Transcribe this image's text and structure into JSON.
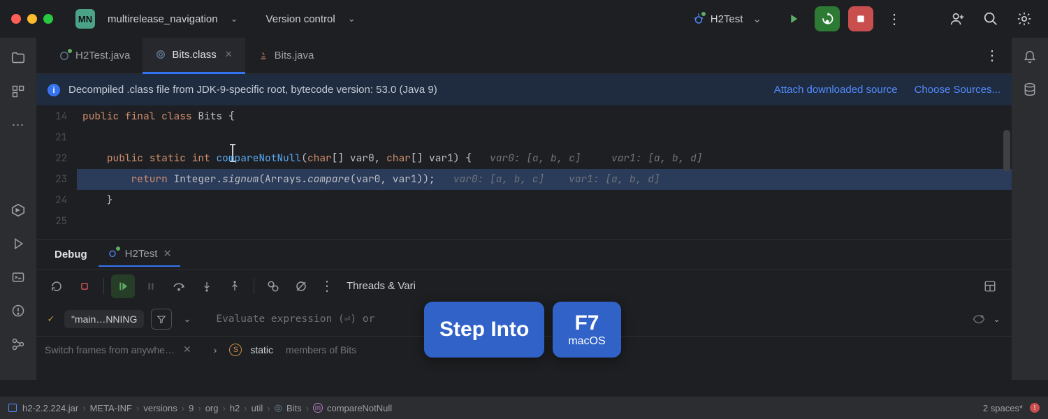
{
  "project": {
    "badge": "MN",
    "name": "multirelease_navigation"
  },
  "vc": {
    "label": "Version control"
  },
  "run_config": {
    "name": "H2Test"
  },
  "tabs": [
    {
      "label": "H2Test.java",
      "active": false,
      "has_dot": true,
      "closeable": false
    },
    {
      "label": "Bits.class",
      "active": true,
      "closeable": true
    },
    {
      "label": "Bits.java",
      "active": false,
      "closeable": false
    }
  ],
  "banner": {
    "text": "Decompiled .class file from JDK-9-specific root, bytecode version: 53.0 (Java 9)",
    "link1": "Attach downloaded source",
    "link2": "Choose Sources..."
  },
  "code": {
    "gutter": [
      "14",
      "21",
      "22",
      "23",
      "24",
      "25"
    ],
    "l14_kw1": "public",
    "l14_kw2": "final",
    "l14_kw3": "class",
    "l14_name": "Bits",
    "l14_brace": " {",
    "l22_kw1": "public",
    "l22_kw2": "static",
    "l22_kw3": "int ",
    "l22_fn": "compareNotNull",
    "l22_sig": "(",
    "l22_kw4": "char",
    "l22_sig2": "[] var0, ",
    "l22_kw5": "char",
    "l22_sig3": "[] var1) {",
    "l22_inlay": "   var0: [a, b, c]     var1: [a, b, d]",
    "l23_kw": "return",
    "l23_call": " Integer.",
    "l23_fn": "signum",
    "l23_args": "(Arrays.",
    "l23_fn2": "compare",
    "l23_args2": "(var0, var1));",
    "l23_inlay": "   var0: [a, b, c]    var1: [a, b, d]",
    "l24": "    }"
  },
  "debug": {
    "tab_debug": "Debug",
    "tab_run": "H2Test",
    "toolbar_label": "Threads & Vari",
    "frame_name": "\"main…NNING",
    "eval_placeholder": "Evaluate expression (⏎) or",
    "hint_text": "Switch frames from anywhe…",
    "vars_strong": "static ",
    "vars_rest": "members of Bits"
  },
  "statusbar": {
    "crumbs": [
      "h2-2.2.224.jar",
      "META-INF",
      "versions",
      "9",
      "org",
      "h2",
      "util",
      "Bits",
      "compareNotNull"
    ],
    "right": "2 spaces*"
  },
  "tooltip": {
    "action": "Step Into",
    "key": "F7",
    "os": "macOS"
  }
}
